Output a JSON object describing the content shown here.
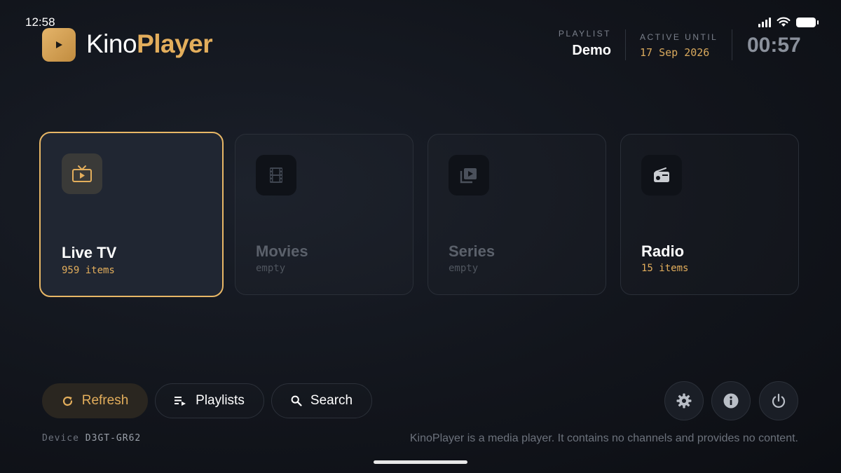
{
  "status_bar": {
    "time": "12:58"
  },
  "app": {
    "name_part1": "Kino",
    "name_part2": "Player"
  },
  "header": {
    "playlist_label": "PLAYLIST",
    "playlist_value": "Demo",
    "active_label": "ACTIVE UNTIL",
    "active_value": "17 Sep 2026",
    "clock": "00:57"
  },
  "categories": [
    {
      "title": "Live TV",
      "subtitle": "959 items",
      "icon": "tv-icon",
      "selected": true
    },
    {
      "title": "Movies",
      "subtitle": "empty",
      "icon": "film-icon",
      "selected": false
    },
    {
      "title": "Series",
      "subtitle": "empty",
      "icon": "video-library-icon",
      "selected": false
    },
    {
      "title": "Radio",
      "subtitle": "15 items",
      "icon": "radio-icon",
      "selected": false
    }
  ],
  "actions": {
    "refresh": "Refresh",
    "playlists": "Playlists",
    "search": "Search"
  },
  "footer": {
    "device_label": "Device",
    "device_id": "D3GT-GR62",
    "disclaimer": "KinoPlayer is a media player. It contains no channels and provides no content."
  },
  "colors": {
    "accent": "#e3ae5c",
    "background": "#12151c",
    "card_active": "#202632",
    "muted": "#6c727c"
  }
}
